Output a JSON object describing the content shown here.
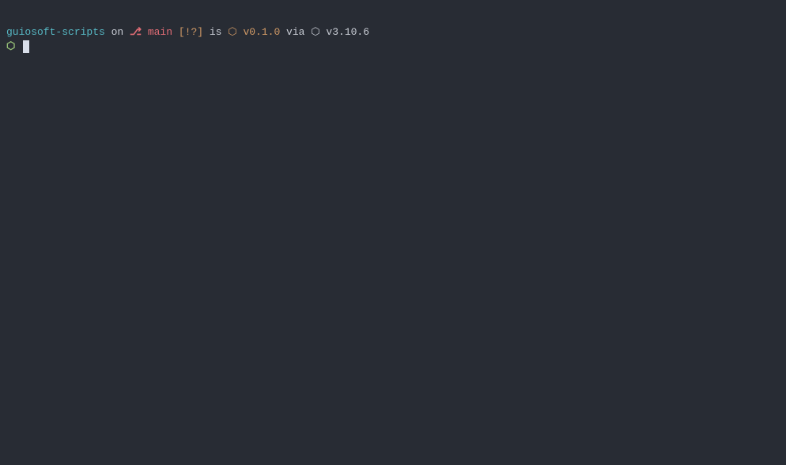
{
  "prompt": {
    "directory": "guiosoft-scripts",
    "on_text": " on ",
    "branch_icon": "⎇",
    "branch_name": " main ",
    "git_status": "[!?]",
    "is_text": " is ",
    "package_icon": "⬡",
    "version1": " v0.1.0",
    "via_text": " via ",
    "python_icon": "⬡",
    "version2": " v3.10.6"
  },
  "input": {
    "prompt_symbol": "⬡ "
  }
}
